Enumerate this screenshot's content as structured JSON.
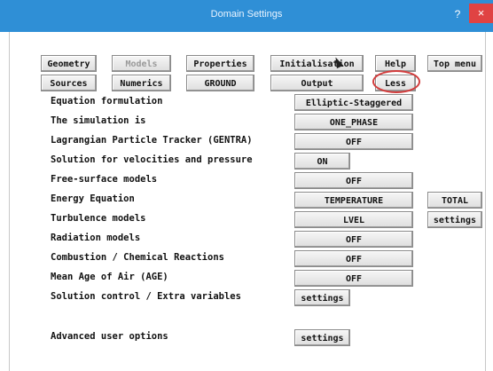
{
  "window": {
    "title": "Domain Settings",
    "help_glyph": "?",
    "close_glyph": "×"
  },
  "toolbar": {
    "row1": [
      "Geometry",
      "Models",
      "Properties",
      "Initialisation",
      "Help",
      "Top menu"
    ],
    "row2": [
      "Sources",
      "Numerics",
      "GROUND",
      "Output",
      "Less"
    ],
    "models_disabled": true,
    "highlighted_button": "Less",
    "highlight_color": "#d23c3c"
  },
  "settings": [
    {
      "label": "Equation formulation",
      "value": "Elliptic-Staggered"
    },
    {
      "label": "The simulation is",
      "value": "ONE_PHASE"
    },
    {
      "label": "Lagrangian Particle Tracker (GENTRA)",
      "value": "OFF"
    },
    {
      "label": "Solution for velocities and pressure",
      "value": "ON"
    },
    {
      "label": "Free-surface models",
      "value": "OFF"
    },
    {
      "label": "Energy Equation",
      "value": "TEMPERATURE",
      "extra": "TOTAL"
    },
    {
      "label": "Turbulence models",
      "value": "LVEL",
      "extra": "settings"
    },
    {
      "label": "Radiation models",
      "value": "OFF"
    },
    {
      "label": "Combustion / Chemical Reactions",
      "value": "OFF"
    },
    {
      "label": "Mean Age of Air (AGE)",
      "value": "OFF"
    },
    {
      "label": "Solution control / Extra variables",
      "value": "settings"
    },
    {
      "label": "Advanced user options",
      "value": "settings"
    }
  ],
  "colors": {
    "titlebar": "#2f8fd6",
    "close": "#e04343"
  }
}
